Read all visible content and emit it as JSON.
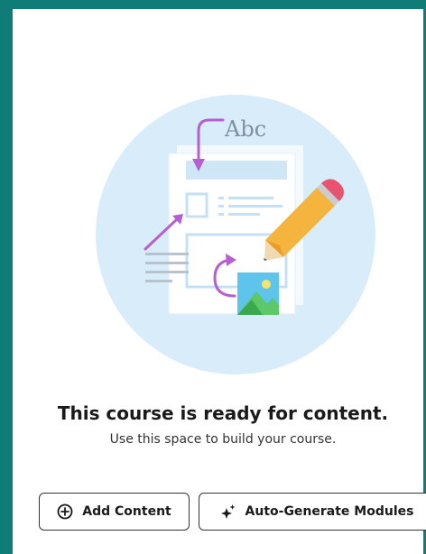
{
  "empty_state": {
    "illustration_text": "Abc",
    "title": "This course is ready for content.",
    "subtitle": "Use this space to build your course."
  },
  "actions": {
    "add_content_label": "Add Content",
    "add_content_icon": "plus-circle-icon",
    "auto_generate_label": "Auto-Generate Modules",
    "auto_generate_icon": "sparkle-icon"
  },
  "colors": {
    "frame": "#0f7c78",
    "circle": "#d9ecf9",
    "accent_purple": "#b65fd0",
    "pencil": "#f5b43d",
    "eraser": "#e8536f"
  }
}
